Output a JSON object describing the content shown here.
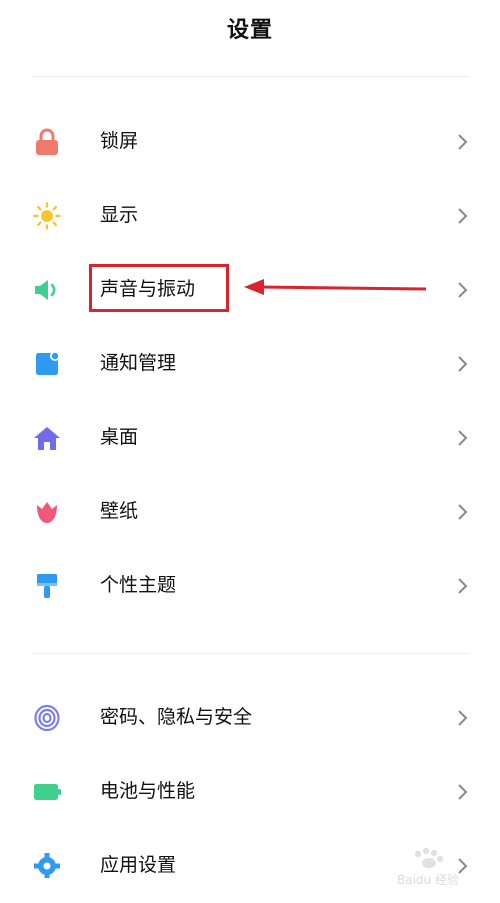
{
  "header": {
    "title": "设置"
  },
  "group1": [
    {
      "label": "锁屏",
      "icon": "lock-icon",
      "color": "#f07a6a"
    },
    {
      "label": "显示",
      "icon": "sun-icon",
      "color": "#f7c531"
    },
    {
      "label": "声音与振动",
      "icon": "speaker-icon",
      "color": "#3fcf8e"
    },
    {
      "label": "通知管理",
      "icon": "notification-icon",
      "color": "#2e9bf0"
    },
    {
      "label": "桌面",
      "icon": "home-icon",
      "color": "#6f6bea"
    },
    {
      "label": "壁纸",
      "icon": "tulip-icon",
      "color": "#f0587a"
    },
    {
      "label": "个性主题",
      "icon": "paintbrush-icon",
      "color": "#2e9bf0"
    }
  ],
  "group2": [
    {
      "label": "密码、隐私与安全",
      "icon": "fingerprint-icon",
      "color": "#7c7fe8"
    },
    {
      "label": "电池与性能",
      "icon": "battery-icon",
      "color": "#3fcf8e"
    },
    {
      "label": "应用设置",
      "icon": "gear-icon",
      "color": "#2e9bf0"
    }
  ],
  "annotation": {
    "highlight_color": "#d9232d"
  },
  "watermark": {
    "text": "Baidu 经验"
  }
}
